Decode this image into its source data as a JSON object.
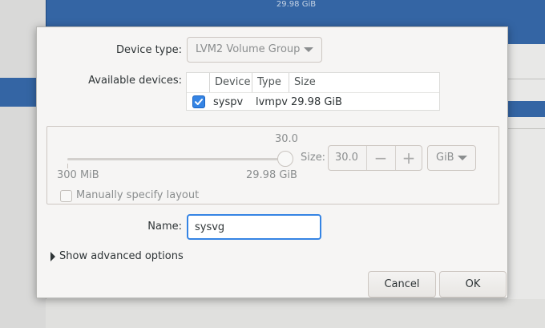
{
  "background": {
    "size_text": "29.98 GiB"
  },
  "dialog": {
    "device_type": {
      "label": "Device type:",
      "value": "LVM2 Volume Group"
    },
    "available_devices": {
      "label": "Available devices:",
      "columns": [
        "Device",
        "Type",
        "Size"
      ],
      "rows": [
        {
          "checked": true,
          "device": "syspv",
          "type": "lvmpv",
          "size": "29.98 GiB"
        }
      ]
    },
    "size": {
      "slider_value": "30.0",
      "min_label": "300 MiB",
      "max_label": "29.98 GiB",
      "label": "Size:",
      "value": "30.0",
      "minus": "−",
      "plus": "+",
      "unit": "GiB",
      "slider_fraction": 1.0
    },
    "manual_layout_label": "Manually specify layout",
    "name": {
      "label": "Name:",
      "value": "sysvg"
    },
    "advanced_options_label": "Show advanced options",
    "cancel_label": "Cancel",
    "ok_label": "OK"
  },
  "colors": {
    "accent": "#3584e4",
    "selection_blue": "#3465a4"
  }
}
